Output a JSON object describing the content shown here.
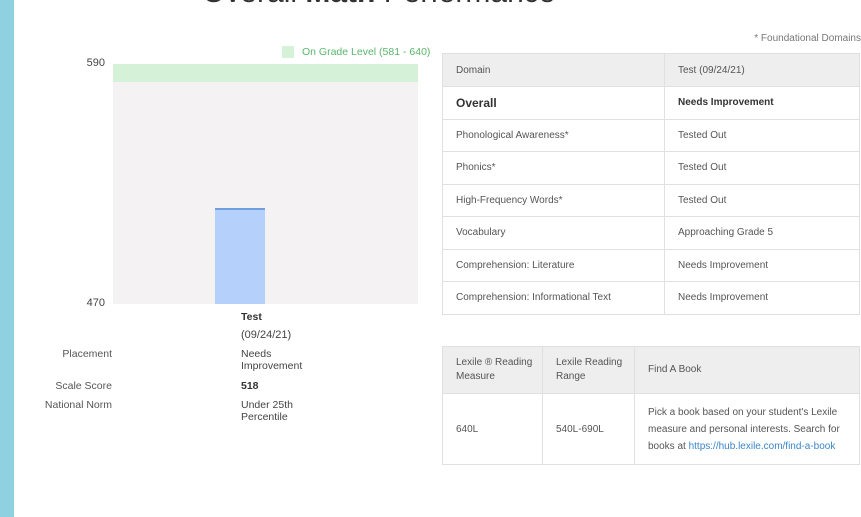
{
  "heading": {
    "part1": "Overall ",
    "part2": "Math",
    "part3": " Performance"
  },
  "chart_data": {
    "type": "bar",
    "categories": [
      "Test"
    ],
    "values": [
      518
    ],
    "ylim": [
      470,
      590
    ],
    "yticks": [
      "590",
      "470"
    ],
    "band": {
      "label": "On Grade Level (581 - 640)",
      "from": 581,
      "to": 640
    },
    "colors": {
      "bar": "#b5d1fb",
      "band": "#d5f2d9"
    }
  },
  "summary": {
    "column_title": "Test",
    "column_date": "(09/24/21)",
    "rows": [
      {
        "label": "Placement",
        "value": "Needs Improvement"
      },
      {
        "label": "Scale Score",
        "value": "518"
      },
      {
        "label": "National Norm",
        "value": "Under 25th Percentile"
      }
    ]
  },
  "footnote": "* Foundational Domains",
  "domains": {
    "headers": [
      "Domain",
      "Test (09/24/21)"
    ],
    "rows": [
      {
        "domain": "Overall",
        "result": "Needs Improvement"
      },
      {
        "domain": "Phonological Awareness*",
        "result": "Tested Out"
      },
      {
        "domain": "Phonics*",
        "result": "Tested Out"
      },
      {
        "domain": "High-Frequency Words*",
        "result": "Tested Out"
      },
      {
        "domain": "Vocabulary",
        "result": "Approaching Grade 5"
      },
      {
        "domain": "Comprehension: Literature",
        "result": "Needs Improvement"
      },
      {
        "domain": "Comprehension: Informational Text",
        "result": "Needs Improvement"
      }
    ]
  },
  "lexile": {
    "headers": [
      "Lexile ® Reading Measure",
      "Lexile Reading Range",
      "Find A Book"
    ],
    "measure": "640L",
    "range": "540L-690L",
    "find_text": "Pick a book based on your student's Lexile measure and personal interests. Search for books at ",
    "link": "https://hub.lexile.com/find-a-book"
  }
}
